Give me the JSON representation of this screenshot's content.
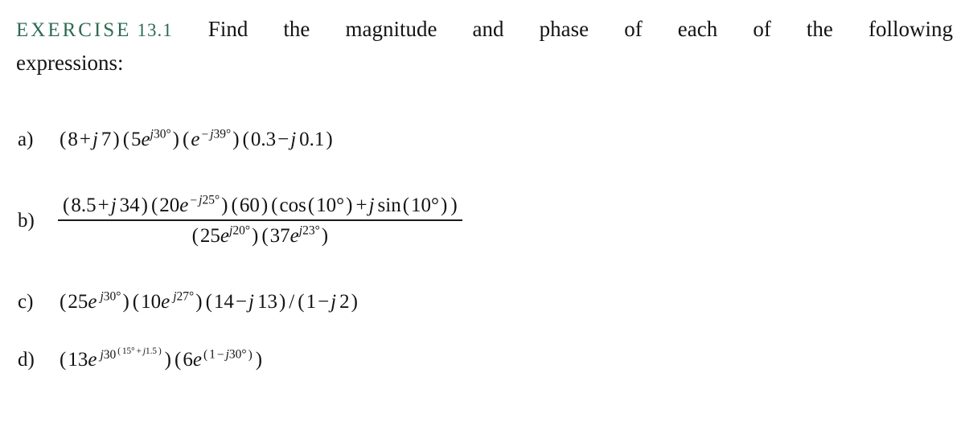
{
  "document": {
    "background_color": "#ffffff",
    "text_color": "#131313",
    "accent_color": "#2d6b52"
  },
  "heading": {
    "exercise_label": "EXERCISE",
    "exercise_number": "13.1",
    "prompt_line1": "Find the magnitude and phase of each of the following",
    "prompt_line2": "expressions:"
  },
  "items": {
    "a": {
      "label": "a)",
      "text": "(8 + j 7)(5e^{j30°})(e^{−j39°})(0.3 − j 0.1)",
      "parts": {
        "p1_open": "(",
        "p1_re": "8",
        "p1_op": "+",
        "p1_j": "j",
        "p1_im": "7",
        "p1_close": ")",
        "p2_open": "(",
        "p2_mag": "5",
        "p2_e": "e",
        "p2_j": "j",
        "p2_ang": "30",
        "p2_deg": "°",
        "p2_close": ")",
        "p3_open": "(",
        "p3_e": "e",
        "p3_sign": "−",
        "p3_j": "j",
        "p3_ang": "39",
        "p3_deg": "°",
        "p3_close": ")",
        "p4_open": "(",
        "p4_re": "0.3",
        "p4_op": "−",
        "p4_j": "j",
        "p4_im": "0.1",
        "p4_close": ")"
      }
    },
    "b": {
      "label": "b)",
      "numerator_text": "(8.5 + j 34)(20e^{−j25°})(60)(cos(10°) + j sin(10°))",
      "denominator_text": "(25e^{j20°})(37e^{j23°})",
      "numerator": {
        "n1_open": "(",
        "n1_re": "8.5",
        "n1_op": "+",
        "n1_j": "j",
        "n1_im": "34",
        "n1_close": ")",
        "n2_open": "(",
        "n2_mag": "20",
        "n2_e": "e",
        "n2_sign": "−",
        "n2_j": "j",
        "n2_ang": "25",
        "n2_deg": "°",
        "n2_close": ")",
        "n3_open": "(",
        "n3_val": "60",
        "n3_close": ")",
        "n4_open": "(",
        "n4_cos": "cos",
        "n4_cos_open": "(",
        "n4_cos_ang": "10",
        "n4_cos_deg": "°",
        "n4_cos_close": ")",
        "n4_op": "+",
        "n4_j": "j",
        "n4_sin": "sin",
        "n4_sin_open": "(",
        "n4_sin_ang": "10",
        "n4_sin_deg": "°",
        "n4_sin_close": ")",
        "n4_close": ")"
      },
      "denominator": {
        "d1_open": "(",
        "d1_mag": "25",
        "d1_e": "e",
        "d1_j": "j",
        "d1_ang": "20",
        "d1_deg": "°",
        "d1_close": ")",
        "d2_open": "(",
        "d2_mag": "37",
        "d2_e": "e",
        "d2_j": "j",
        "d2_ang": "23",
        "d2_deg": "°",
        "d2_close": ")"
      }
    },
    "c": {
      "label": "c)",
      "text": "(25e^{j30°})(10e^{j27°})(14 − j 13)/(1 − j 2)",
      "parts": {
        "p1_open": "(",
        "p1_mag": "25",
        "p1_e": "e",
        "p1_j": "j",
        "p1_ang": "30",
        "p1_deg": "°",
        "p1_close": ")",
        "p2_open": "(",
        "p2_mag": "10",
        "p2_e": "e",
        "p2_j": "j",
        "p2_ang": "27",
        "p2_deg": "°",
        "p2_close": ")",
        "p3_open": "(",
        "p3_re": "14",
        "p3_op": "−",
        "p3_j": "j",
        "p3_im": "13",
        "p3_close": ")",
        "p_div": "/",
        "p4_open": "(",
        "p4_re": "1",
        "p4_op": "−",
        "p4_j": "j",
        "p4_im": "2",
        "p4_close": ")"
      }
    },
    "d": {
      "label": "d)",
      "text": "(13e^{j30^{(15°+j1.5)}})(6e^{(1−j30°)})",
      "parts": {
        "p1_open": "(",
        "p1_mag": "13",
        "p1_e": "e",
        "p1_j": "j",
        "p1_base": "30",
        "p1_sup_open": "(",
        "p1_sup_ang": "15",
        "p1_sup_deg": "°",
        "p1_sup_op": "+",
        "p1_sup_j": "j",
        "p1_sup_val": "1.5",
        "p1_sup_close": ")",
        "p1_close": ")",
        "p2_open": "(",
        "p2_mag": "6",
        "p2_e": "e",
        "p2_exp_open": "(",
        "p2_exp_re": "1",
        "p2_exp_op": "−",
        "p2_exp_j": "j",
        "p2_exp_ang": "30",
        "p2_exp_deg": "°",
        "p2_exp_close": ")",
        "p2_close": ")"
      }
    }
  }
}
